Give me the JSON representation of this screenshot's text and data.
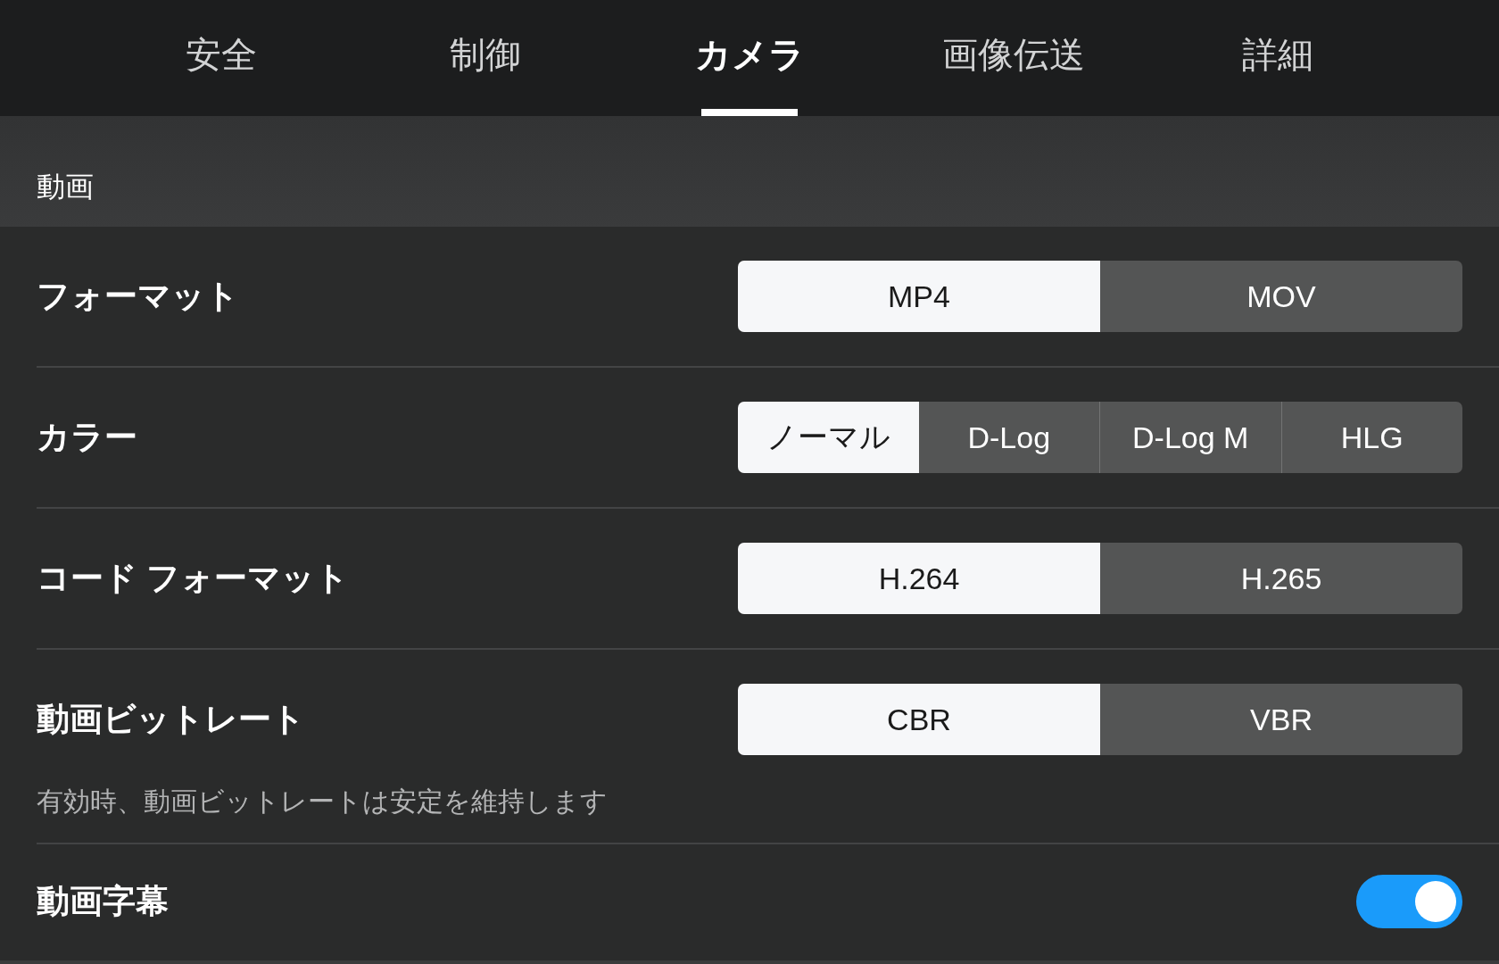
{
  "tabs": [
    {
      "label": "安全",
      "selected": false
    },
    {
      "label": "制御",
      "selected": false
    },
    {
      "label": "カメラ",
      "selected": true
    },
    {
      "label": "画像伝送",
      "selected": false
    },
    {
      "label": "詳細",
      "selected": false
    }
  ],
  "section": {
    "title": "動画"
  },
  "settings": [
    {
      "kind": "segmented",
      "label": "フォーマット",
      "options": [
        {
          "label": "MP4",
          "selected": true
        },
        {
          "label": "MOV",
          "selected": false
        }
      ]
    },
    {
      "kind": "segmented",
      "label": "カラー",
      "options": [
        {
          "label": "ノーマル",
          "selected": true
        },
        {
          "label": "D-Log",
          "selected": false
        },
        {
          "label": "D-Log M",
          "selected": false
        },
        {
          "label": "HLG",
          "selected": false
        }
      ]
    },
    {
      "kind": "segmented",
      "label": "コード フォーマット",
      "options": [
        {
          "label": "H.264",
          "selected": true
        },
        {
          "label": "H.265",
          "selected": false
        }
      ]
    },
    {
      "kind": "segmented",
      "label": "動画ビットレート",
      "options": [
        {
          "label": "CBR",
          "selected": true
        },
        {
          "label": "VBR",
          "selected": false
        }
      ],
      "description": "有効時、動画ビットレートは安定を維持します"
    },
    {
      "kind": "toggle",
      "label": "動画字幕",
      "on": true
    }
  ]
}
